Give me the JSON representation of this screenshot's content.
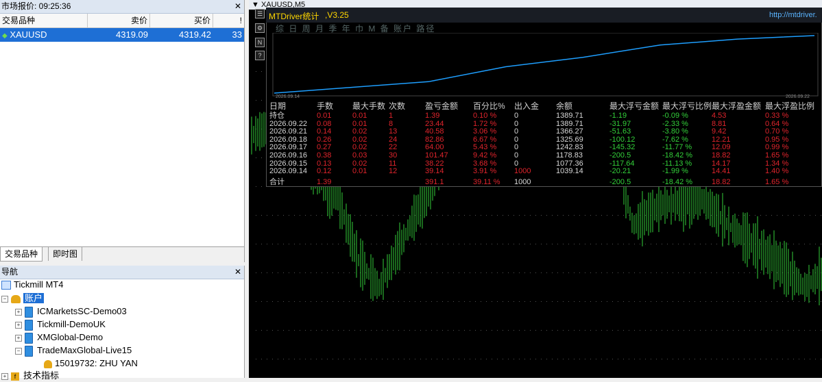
{
  "market_watch": {
    "title": "市场报价: 09:25:36",
    "columns": [
      "交易品种",
      "卖价",
      "买价",
      "!"
    ],
    "rows": [
      {
        "symbol": "XAUUSD",
        "bid": "4319.09",
        "ask": "4319.42",
        "spread": "33"
      }
    ],
    "tabs": [
      "交易品种",
      "即时图"
    ]
  },
  "navigator": {
    "title": "导航",
    "root": "Tickmill MT4",
    "accounts_label": "账户",
    "accounts": [
      "ICMarketsSC-Demo03",
      "Tickmill-DemoUK",
      "XMGlobal-Demo",
      "TradeMaxGlobal-Live15"
    ],
    "user": "15019732: ZHU YAN",
    "indicators": "技术指标"
  },
  "chart": {
    "title": "XAUUSD,M5",
    "colors": {
      "candle": "#33d13a",
      "line": "#1e9fff",
      "profit": "#e0242c",
      "loss": "#33d13a"
    }
  },
  "mtdriver": {
    "title": "MTDriver统计",
    "version": ",V3.25",
    "url": "http://mtdriver.",
    "menu": "综 日 周 月 季 年 巾 M 备 账户    路径",
    "date_start": "2026.09.14",
    "date_end": "2026.09.22",
    "headers": [
      "日期",
      "手数",
      "最大手数",
      "次数",
      "盈亏金额",
      "百分比%",
      "出入金",
      "余额",
      "最大浮亏金额",
      "最大浮亏比例",
      "最大浮盈金额",
      "最大浮盈比例"
    ],
    "rows": [
      [
        "持仓",
        "0.01",
        "0.01",
        "1",
        "1.39",
        "0.10 %",
        "0",
        "1389.71",
        "-1.19",
        "-0.09 %",
        "4.53",
        "0.33 %"
      ],
      [
        "2026.09.22",
        "0.08",
        "0.01",
        "8",
        "23.44",
        "1.72 %",
        "0",
        "1389.71",
        "-31.97",
        "-2.33 %",
        "8.81",
        "0.64 %"
      ],
      [
        "2026.09.21",
        "0.14",
        "0.02",
        "13",
        "40.58",
        "3.06 %",
        "0",
        "1366.27",
        "-51.63",
        "-3.80 %",
        "9.42",
        "0.70 %"
      ],
      [
        "2026.09.18",
        "0.26",
        "0.02",
        "24",
        "82.86",
        "6.67 %",
        "0",
        "1325.69",
        "-100.12",
        "-7.62 %",
        "12.21",
        "0.95 %"
      ],
      [
        "2026.09.17",
        "0.27",
        "0.02",
        "22",
        "64.00",
        "5.43 %",
        "0",
        "1242.83",
        "-145.32",
        "-11.77 %",
        "12.09",
        "0.99 %"
      ],
      [
        "2026.09.16",
        "0.38",
        "0.03",
        "30",
        "101.47",
        "9.42 %",
        "0",
        "1178.83",
        "-200.5",
        "-18.42 %",
        "18.82",
        "1.65 %"
      ],
      [
        "2026.09.15",
        "0.13",
        "0.02",
        "11",
        "38.22",
        "3.68 %",
        "0",
        "1077.36",
        "-117.64",
        "-11.13 %",
        "14.17",
        "1.34 %"
      ],
      [
        "2026.09.14",
        "0.12",
        "0.01",
        "12",
        "39.14",
        "3.91 %",
        "1000",
        "1039.14",
        "-20.21",
        "-1.99 %",
        "14.41",
        "1.40 %"
      ]
    ],
    "total": [
      "合计",
      "1.39",
      "",
      "",
      "391.1",
      "39.11 %",
      "1000",
      "",
      "-200.5",
      "-18.42 %",
      "18.82",
      "1.65 %"
    ]
  }
}
